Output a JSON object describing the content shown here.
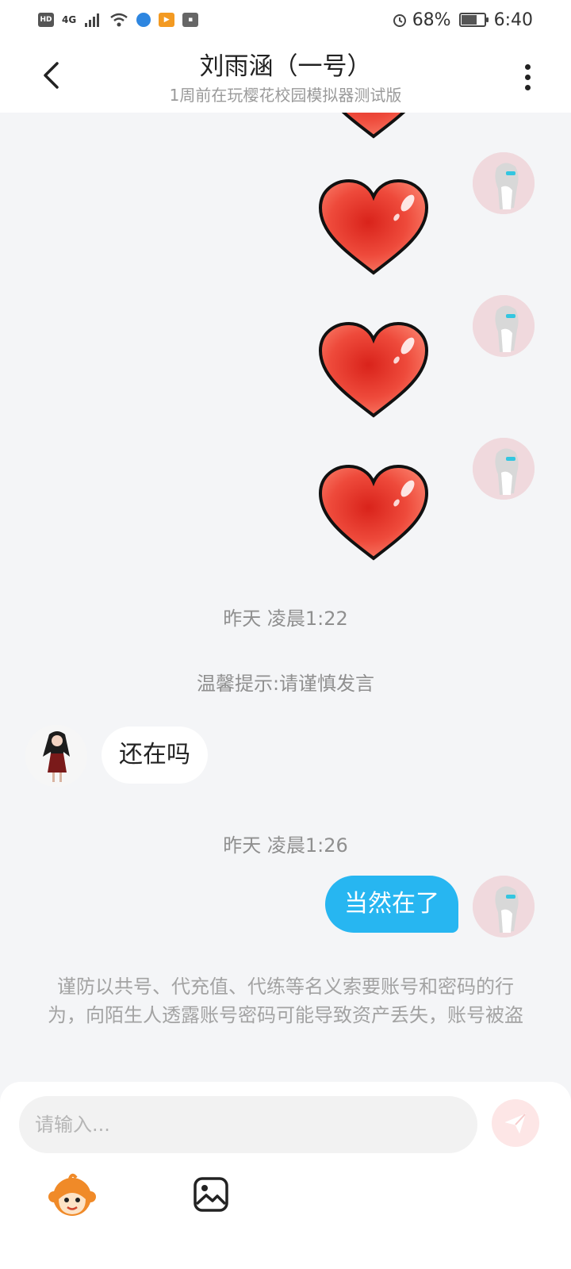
{
  "status_bar": {
    "hd": "HD",
    "network": "4G",
    "battery_text": "68%",
    "battery_level": 0.68,
    "time": "6:40"
  },
  "header": {
    "title": "刘雨涵（一号）",
    "subtitle": "1周前在玩樱花校园模拟器测试版",
    "back_icon": "chevron-left-icon",
    "more_icon": "more-vertical-icon"
  },
  "messages": {
    "stickers": [
      "heart-sticker",
      "heart-sticker",
      "heart-sticker",
      "heart-sticker"
    ],
    "timestamp_1": "昨天 凌晨1:22",
    "tip": "温馨提示:请谨慎发言",
    "incoming_text": "还在吗",
    "timestamp_2": "昨天 凌晨1:26",
    "outgoing_text": "当然在了",
    "warning": "谨防以共号、代充值、代练等名义索要账号和密码的行为，向陌生人透露账号密码可能导致资产丢失，账号被盗"
  },
  "input": {
    "placeholder": "请输入...",
    "send_icon": "send-icon",
    "emoji_icon": "monkey-emoji-icon",
    "image_icon": "image-icon"
  },
  "colors": {
    "outgoing_bubble": "#27b6f1",
    "heart": "#e8362c",
    "background": "#f4f5f7"
  }
}
